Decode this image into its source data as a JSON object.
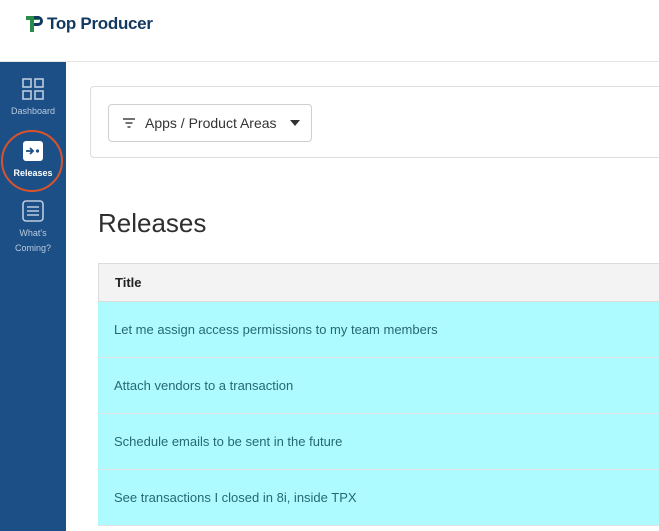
{
  "app": {
    "brand": "Top Producer"
  },
  "sidebar": {
    "items": [
      {
        "label": "Dashboard",
        "icon": "dashboard-grid-icon",
        "active": false
      },
      {
        "label": "Releases",
        "icon": "releases-icon",
        "active": true
      },
      {
        "label": "What's\nComing?",
        "icon": "whats-coming-icon",
        "active": false
      }
    ]
  },
  "filter": {
    "label": "Apps / Product Areas",
    "icon": "filter-icon"
  },
  "main": {
    "title": "Releases",
    "table": {
      "header": "Title",
      "rows": [
        "Let me assign access permissions to my team members",
        "Attach vendors to a transaction",
        "Schedule emails to be sent in the future",
        "See transactions I closed in 8i, inside TPX"
      ]
    }
  },
  "colors": {
    "sidebar": "#1c4f86",
    "row_highlight": "#adfbff",
    "row_text": "#266873",
    "annotation_ring": "#d9532c",
    "brand_text": "#12395f"
  }
}
